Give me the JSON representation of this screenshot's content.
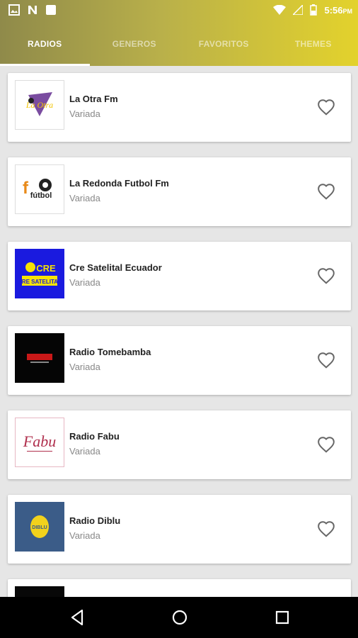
{
  "status_bar": {
    "time": "5:56",
    "ampm": "PM"
  },
  "tabs": [
    {
      "label": "RADIOS",
      "active": true
    },
    {
      "label": "GENEROS",
      "active": false
    },
    {
      "label": "FAVORITOS",
      "active": false
    },
    {
      "label": "THEMES",
      "active": false
    }
  ],
  "stations": [
    {
      "name": "La Otra Fm",
      "genre": "Variada",
      "logo_text": "La Otra"
    },
    {
      "name": "La Redonda Futbol Fm",
      "genre": "Variada",
      "logo_text": "fútbol"
    },
    {
      "name": "Cre Satelital Ecuador",
      "genre": "Variada",
      "logo_text": "CRE SATELITAL"
    },
    {
      "name": "Radio Tomebamba",
      "genre": "Variada",
      "logo_text": ""
    },
    {
      "name": "Radio Fabu",
      "genre": "Variada",
      "logo_text": "Fabu"
    },
    {
      "name": "Radio Diblu",
      "genre": "Variada",
      "logo_text": "DIBLU"
    }
  ],
  "colors": {
    "accent": "#e3d22c",
    "heart": "#666666"
  }
}
